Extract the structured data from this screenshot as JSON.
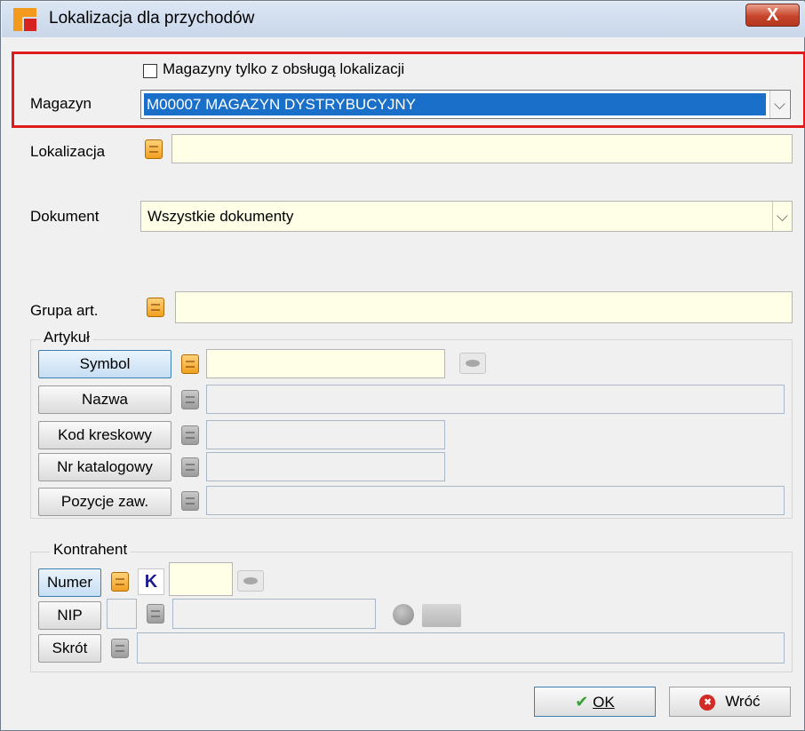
{
  "window": {
    "title": "Lokalizacja dla przychodów",
    "close_label": "X"
  },
  "magazyn": {
    "checkbox_label": "Magazyny tylko z obsługą lokalizacji",
    "checked": false,
    "label": "Magazyn",
    "value": "M00007 MAGAZYN DYSTRYBUCYJNY"
  },
  "lokalizacja": {
    "label": "Lokalizacja",
    "value": ""
  },
  "dokument": {
    "label": "Dokument",
    "value": "Wszystkie dokumenty"
  },
  "grupa": {
    "label": "Grupa art.",
    "value": ""
  },
  "artykul": {
    "title": "Artykuł",
    "rows": [
      {
        "label": "Symbol"
      },
      {
        "label": "Nazwa"
      },
      {
        "label": "Kod kreskowy"
      },
      {
        "label": "Nr katalogowy"
      },
      {
        "label": "Pozycje zaw."
      }
    ]
  },
  "kontrahent": {
    "title": "Kontrahent",
    "numer_label": "Numer",
    "k_label": "K",
    "nip_label": "NIP",
    "skrot_label": "Skrót"
  },
  "buttons": {
    "ok_label": "OK",
    "back_label": "Wróć"
  },
  "icons": {
    "check": "✔",
    "back": "✖",
    "dropdown": "⌵"
  },
  "colors": {
    "highlight": "#e0191b",
    "selection": "#1a6fc9",
    "field_bg": "#fffee6"
  }
}
